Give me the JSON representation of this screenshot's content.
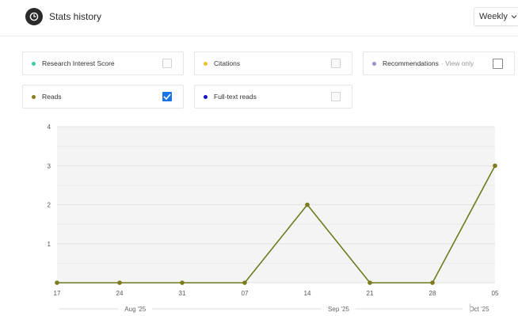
{
  "header": {
    "title": "Stats history",
    "period_label": "Weekly"
  },
  "metrics": [
    {
      "label": "Research Interest Score",
      "hint": "",
      "color": "#3cc9a8",
      "checked": false
    },
    {
      "label": "Citations",
      "hint": "",
      "color": "#f2c230",
      "checked": false
    },
    {
      "label": "Recommendations",
      "hint": "· View only",
      "color": "#9b8fd6",
      "checked": false
    },
    {
      "label": "Reads",
      "hint": "",
      "color": "#8a7a1c",
      "checked": true
    },
    {
      "label": "Full-text reads",
      "hint": "",
      "color": "#1414c8",
      "checked": false
    }
  ],
  "chart_data": {
    "type": "line",
    "x": [
      "17",
      "24",
      "31",
      "07",
      "14",
      "21",
      "28",
      "05"
    ],
    "series": [
      {
        "values": [
          0,
          0,
          0,
          0,
          2,
          0,
          0,
          3
        ],
        "color": "#8a7a1c",
        "point_color": "#7d7a1f"
      }
    ],
    "ylim": [
      0,
      4
    ],
    "y_ticks": [
      "1",
      "2",
      "3",
      "4"
    ],
    "y_zero_tick": "",
    "months": [
      {
        "label": "Aug '25",
        "start_index": 0,
        "end_index": 2.5
      },
      {
        "label": "Sep '25",
        "start_index": 2.5,
        "end_index": 6.5
      },
      {
        "label": "Oct '25",
        "start_index": 6.5,
        "end_index": 7
      }
    ],
    "line_color": "#6b7a1d",
    "grid": true,
    "title": "",
    "xlabel": "",
    "ylabel": ""
  }
}
